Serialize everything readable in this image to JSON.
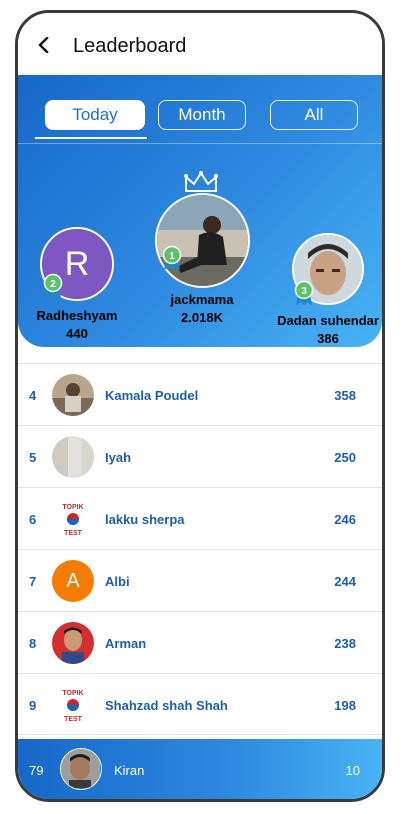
{
  "header": {
    "title": "Leaderboard"
  },
  "tabs": [
    {
      "label": "Today",
      "active": true
    },
    {
      "label": "Month",
      "active": false
    },
    {
      "label": "All",
      "active": false
    }
  ],
  "podium": [
    {
      "position": 2,
      "name": "Radheshyam",
      "score": "440",
      "initial": "R",
      "avatar_color": "#7e57c2"
    },
    {
      "position": 1,
      "name": "jackmama",
      "score": "2.018K"
    },
    {
      "position": 3,
      "name": "Dadan suhendar",
      "score": "386"
    }
  ],
  "list": [
    {
      "rank": "4",
      "name": "Kamala Poudel",
      "score": "358",
      "avatar": "photo"
    },
    {
      "rank": "5",
      "name": "Iyah",
      "score": "250",
      "avatar": "photo"
    },
    {
      "rank": "6",
      "name": "lakku sherpa",
      "score": "246",
      "avatar": "topik",
      "badge_text_top": "TOPIK",
      "badge_text_bottom": "TEST"
    },
    {
      "rank": "7",
      "name": "Albi",
      "score": "244",
      "avatar": "letter",
      "initial": "A",
      "avatar_color": "#f57c00"
    },
    {
      "rank": "8",
      "name": "Arman",
      "score": "238",
      "avatar": "photo"
    },
    {
      "rank": "9",
      "name": "Shahzad shah Shah",
      "score": "198",
      "avatar": "topik",
      "badge_text_top": "TOPIK",
      "badge_text_bottom": "TEST"
    }
  ],
  "current_user": {
    "rank": "79",
    "name": "Kiran",
    "score": "10"
  },
  "colors": {
    "accent": "#1e6fcf",
    "list_text": "#1e5fa8"
  }
}
